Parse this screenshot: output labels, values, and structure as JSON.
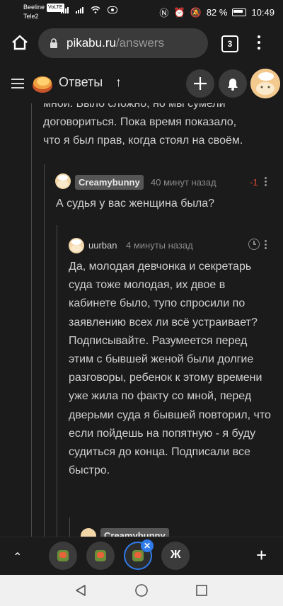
{
  "status_bar": {
    "carrier1": "Beeline",
    "lte": "VoLTE",
    "carrier2": "Tele2",
    "battery": "82 %",
    "time": "10:49"
  },
  "browser": {
    "url_domain": "pikabu.ru",
    "url_path": "/answers",
    "tab_count": "3"
  },
  "app_bar": {
    "title": "Ответы",
    "arrow": "↑"
  },
  "thread": {
    "prev_text": [
      "мной. Было сложно, но мы сумели",
      "договориться. Пока время показало,",
      "что я был прав, когда стоял на своём."
    ],
    "comment1": {
      "author": "Creamybunny",
      "time": "40 минут назад",
      "score": "-1",
      "text": "А судья у вас женщина была?"
    },
    "comment2": {
      "author": "uurban",
      "time": "4 минуты назад",
      "text": "Да, молодая девчонка и секретарь суда тоже молодая, их двое в кабинете было, тупо спросили по заявлению всех ли всё устраивает? Подписывайте. Разумеется перед этим с бывшей женой были долгие разговоры, ребенок к этому времени уже жила по факту со мной, перед дверьми суда я бывшей повторил, что если пойдешь на попятную - я буду судиться до конца. Подписали все быстро."
    },
    "comment3": {
      "author": "Creamybunny"
    }
  },
  "tab_switcher": {
    "tab4_label": "Ж"
  },
  "icons": {
    "home": "home-icon",
    "lock": "lock-icon",
    "menu": "menu-icon",
    "bell": "bell-icon",
    "clock": "clock-icon"
  },
  "colors": {
    "accent_blue": "#2f7bea",
    "score_red": "#e2493a",
    "background": "#1b1b1b"
  }
}
